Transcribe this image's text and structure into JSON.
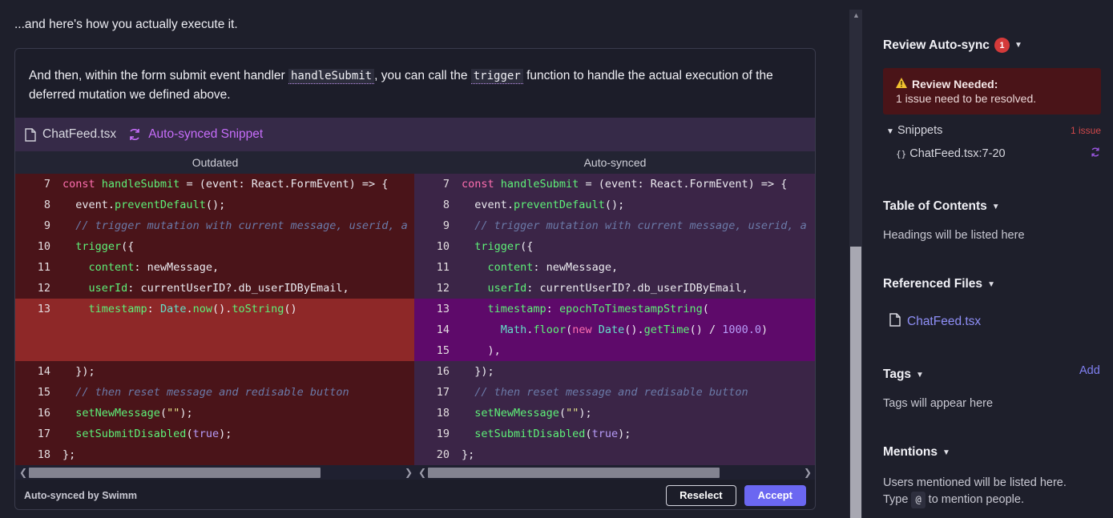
{
  "doc": {
    "intro": "...and here's how you actually execute it.",
    "paragraph": {
      "before": "And then, within the form submit event handler ",
      "code1": "handleSubmit",
      "middle": ", you can call the ",
      "code2": "trigger",
      "after": " function to handle the actual execution of the deferred mutation we defined above."
    },
    "snippet": {
      "file": "ChatFeed.tsx",
      "status": "Auto-synced Snippet",
      "outdated_label": "Outdated",
      "synced_label": "Auto-synced",
      "footer_label": "Auto-synced by Swimm",
      "reselect_label": "Reselect",
      "accept_label": "Accept",
      "left_lines": [
        {
          "num": "7",
          "code": "const handleSubmit = (event: React.FormEvent) => {"
        },
        {
          "num": "8",
          "code": "  event.preventDefault();"
        },
        {
          "num": "9",
          "code": "  // trigger mutation with current message, userid, a"
        },
        {
          "num": "10",
          "code": "  trigger({"
        },
        {
          "num": "11",
          "code": "    content: newMessage,"
        },
        {
          "num": "12",
          "code": "    userId: currentUserID?.db_userIDByEmail,"
        },
        {
          "num": "13",
          "code": "    timestamp: Date.now().toString()",
          "hl": true,
          "tall": true
        },
        {
          "num": "14",
          "code": "  });"
        },
        {
          "num": "15",
          "code": "  // then reset message and redisable button"
        },
        {
          "num": "16",
          "code": "  setNewMessage(\"\");"
        },
        {
          "num": "17",
          "code": "  setSubmitDisabled(true);"
        },
        {
          "num": "18",
          "code": "};"
        }
      ],
      "right_lines": [
        {
          "num": "7",
          "code": "const handleSubmit = (event: React.FormEvent) => {"
        },
        {
          "num": "8",
          "code": "  event.preventDefault();"
        },
        {
          "num": "9",
          "code": "  // trigger mutation with current message, userid, a"
        },
        {
          "num": "10",
          "code": "  trigger({"
        },
        {
          "num": "11",
          "code": "    content: newMessage,"
        },
        {
          "num": "12",
          "code": "    userId: currentUserID?.db_userIDByEmail,"
        },
        {
          "num": "13",
          "code": "    timestamp: epochToTimestampString(",
          "hl": true
        },
        {
          "num": "14",
          "code": "      Math.floor(new Date().getTime() / 1000.0)",
          "hl": true
        },
        {
          "num": "15",
          "code": "    ),",
          "hl": true
        },
        {
          "num": "16",
          "code": "  });"
        },
        {
          "num": "17",
          "code": "  // then reset message and redisable button"
        },
        {
          "num": "18",
          "code": "  setNewMessage(\"\");"
        },
        {
          "num": "19",
          "code": "  setSubmitDisabled(true);"
        },
        {
          "num": "20",
          "code": "};"
        }
      ]
    }
  },
  "sidebar": {
    "review": {
      "title": "Review Auto-sync",
      "badge": "1",
      "alert_title": "Review Needed:",
      "alert_msg": "1 issue need to be resolved.",
      "snippets_label": "Snippets",
      "issue_count": "1 issue",
      "snippet_ref": "ChatFeed.tsx:7-20"
    },
    "toc": {
      "title": "Table of Contents",
      "empty": "Headings will be listed here"
    },
    "refs": {
      "title": "Referenced Files",
      "file": "ChatFeed.tsx"
    },
    "tags": {
      "title": "Tags",
      "add": "Add",
      "empty": "Tags will appear here"
    },
    "mentions": {
      "title": "Mentions",
      "line1": "Users mentioned will be listed here.",
      "type_word": "Type",
      "key": "@",
      "line2_after": "to mention people."
    }
  },
  "colors": {
    "accent": "#6b67f1",
    "sync": "#c66dfa",
    "danger": "#d43a3a",
    "outdated_bg": "#4a1419",
    "synced_bg": "#3b2547"
  }
}
